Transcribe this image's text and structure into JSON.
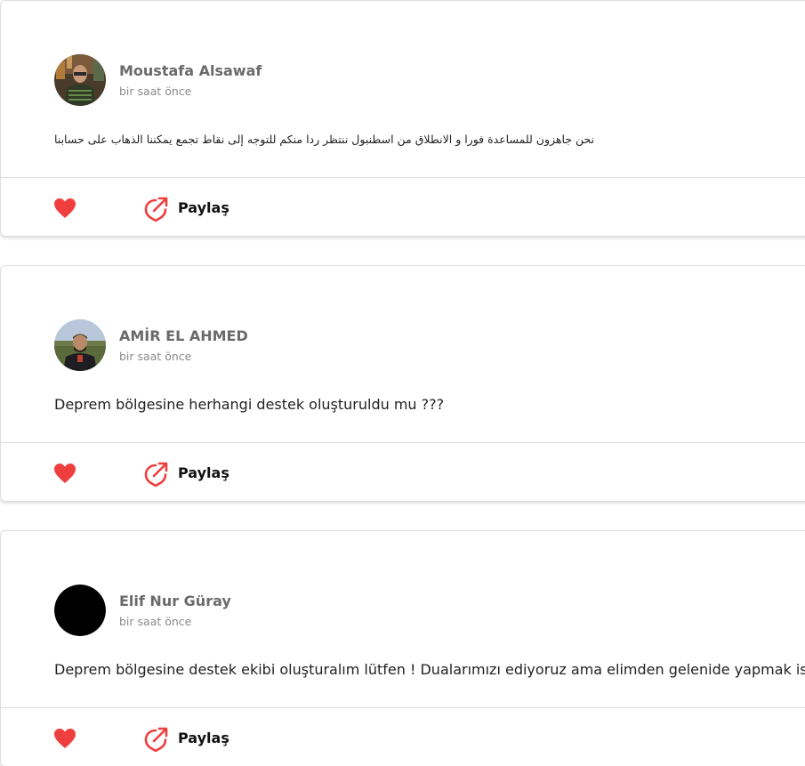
{
  "feed": {
    "posts": [
      {
        "author": "Moustafa Alsawaf",
        "time": "bir saat önce",
        "text": "نحن جاهزون للمساعدة فورا و الانطلاق من اسطنبول ننتظر ردا منكم للتوجه إلى نقاط تجمع يمكننا الذهاب على حسابنا",
        "like_count": "",
        "share_label": "Paylaş",
        "avatar": "photo"
      },
      {
        "author": "AMİR EL AHMED",
        "time": "bir saat önce",
        "text": "Deprem bölgesine herhangi destek oluşturuldu mu ???",
        "like_count": "",
        "share_label": "Paylaş",
        "avatar": "photo"
      },
      {
        "author": "Elif Nur Güray",
        "time": "bir saat önce",
        "text": "Deprem bölgesine destek ekibi oluşturalım lütfen ! Dualarımızı ediyoruz ama elimden gelenide yapmak istiyorum ..",
        "like_count": "",
        "share_label": "Paylaş",
        "avatar": "black-circle"
      }
    ]
  },
  "colors": {
    "heart": "#ef3e3e",
    "share_icon": "#ef3e3e",
    "author_text": "#6a6a6a",
    "time_text": "#8a8a8a",
    "body_text": "#222222",
    "divider": "#dcdcdc"
  },
  "icons": {
    "like": "heart-icon",
    "share": "share-arrow-icon"
  }
}
